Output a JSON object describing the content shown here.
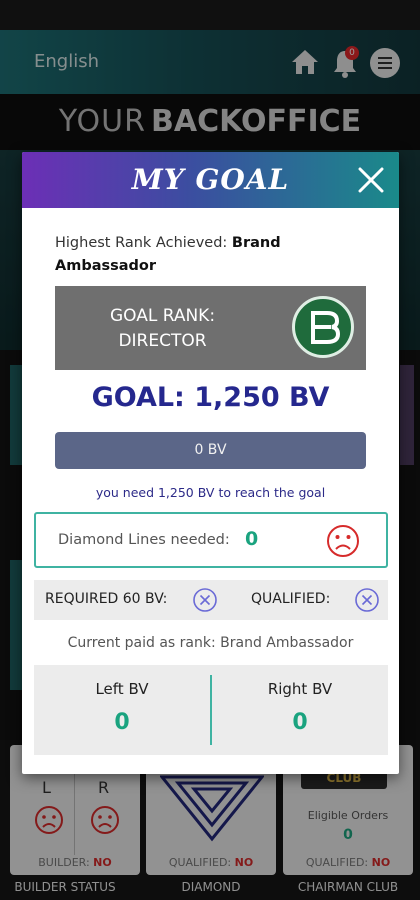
{
  "topbar": {
    "language": "English",
    "notification_count": "0",
    "icons": [
      "home-icon",
      "bell-icon",
      "menu-icon"
    ]
  },
  "brand": {
    "prefix": "YOUR",
    "name": "BACKOFFICE"
  },
  "tiles": [
    {
      "title": "BUILDER STATUS",
      "left_letter": "L",
      "right_letter": "R",
      "status_label": "BUILDER:",
      "status_value": "NO"
    },
    {
      "title": "DIAMOND",
      "status_label": "QUALIFIED:",
      "status_value": "NO"
    },
    {
      "title": "CHAIRMAN CLUB",
      "badge": "CLUB",
      "eligible_label": "Eligible Orders",
      "eligible_value": "0",
      "status_label": "QUALIFIED:",
      "status_value": "NO"
    }
  ],
  "modal": {
    "title": "MY GOAL",
    "highest_rank_label": "Highest Rank Achieved:",
    "highest_rank_value": "Brand Ambassador",
    "goal_rank_line1": "GOAL RANK:",
    "goal_rank_line2": "DIRECTOR",
    "goal_bv": "GOAL: 1,250 BV",
    "progress": {
      "text": "0 BV",
      "fraction": 0
    },
    "need_text": "you need 1,250 BV to reach the goal",
    "diamond_label": "Diamond Lines needed:",
    "diamond_value": "0",
    "required_label": "REQUIRED 60 BV:",
    "qualified_label": "QUALIFIED:",
    "current_paid": "Current paid as rank: Brand Ambassador",
    "left_bv_label": "Left BV",
    "left_bv_value": "0",
    "right_bv_label": "Right BV",
    "right_bv_value": "0"
  },
  "colors": {
    "accent_green": "#1aa37f",
    "goal_blue": "#25288e",
    "status_red": "#d62b2b",
    "header_purple": "#6c2fb6",
    "header_teal": "#1a8a8a"
  }
}
